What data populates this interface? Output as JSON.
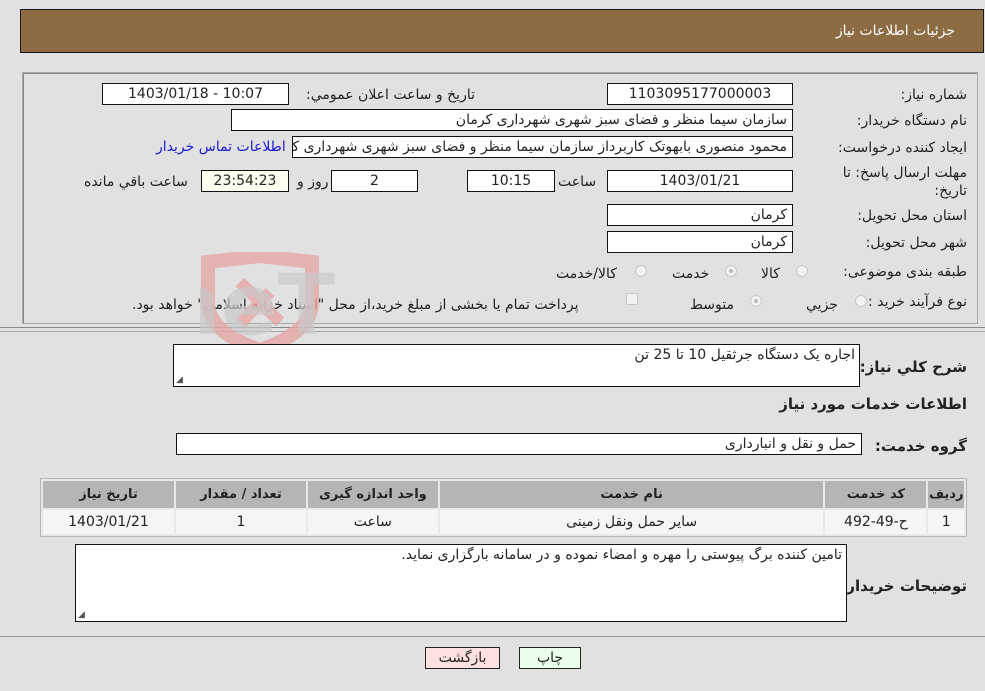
{
  "header": {
    "title": "جزئیات اطلاعات نیاز"
  },
  "form": {
    "need_number": {
      "label": "شماره نیاز:",
      "value": "1103095177000003"
    },
    "announce_datetime": {
      "label": "تاریخ و ساعت اعلان عمومي:",
      "value": "1403/01/18 - 10:07"
    },
    "buyer_org": {
      "label": "نام دستگاه خریدار:",
      "value": "سازمان سیما منظر و فضای سبز شهری شهرداری کرمان"
    },
    "requester": {
      "label": "ایجاد کننده درخواست:",
      "value": "محمود منصوری بابهوتک کاربرداز سازمان سیما منظر و فضای سبز شهری شهرداری کرمان"
    },
    "buyer_contact_link": "اطلاعات تماس خریدار",
    "deadline": {
      "label": "مهلت ارسال پاسخ: تا تاریخ:",
      "date": "1403/01/21",
      "time_label": "ساعت",
      "time": "10:15",
      "days": "2",
      "days_label": "روز و",
      "remaining": "23:54:23",
      "remaining_label": "ساعت باقي مانده"
    },
    "province": {
      "label": "استان محل تحویل:",
      "value": "کرمان"
    },
    "city": {
      "label": "شهر محل تحویل:",
      "value": "کرمان"
    },
    "category": {
      "label": "طبقه بندی موضوعی:",
      "options": [
        "کالا",
        "خدمت",
        "کالا/خدمت"
      ],
      "selected": "خدمت"
    },
    "purchase_type": {
      "label": "نوع فرآیند خرید :",
      "options": [
        "جزيي",
        "متوسط"
      ],
      "selected": "متوسط",
      "treasury_note": "پرداخت تمام یا بخشی از مبلغ خرید،از محل \"اسناد خزانه اسلامی\" خواهد بود."
    }
  },
  "summary": {
    "label": "شرح کلي نیاز:",
    "value": "اجاره یک دستگاه جرثقیل 10 تا 25 تن"
  },
  "services": {
    "section_title": "اطلاعات خدمات مورد نیاز",
    "group_label": "گروه خدمت:",
    "group_value": "حمل و نقل و انبارداری",
    "table": {
      "headers": [
        "ردیف",
        "کد خدمت",
        "نام خدمت",
        "واحد اندازه گیری",
        "تعداد / مقدار",
        "تاریخ نیاز"
      ],
      "rows": [
        [
          "1",
          "ح-49-492",
          "سایر حمل ونقل زمینی",
          "ساعت",
          "1",
          "1403/01/21"
        ]
      ]
    }
  },
  "buyer_notes": {
    "label": "توضیحات خریدار:",
    "value": "تامین کننده برگ پیوستی را مهره و امضاء نموده و در سامانه بارگزاری نماید."
  },
  "buttons": {
    "print": "چاپ",
    "back": "بازگشت"
  },
  "colors": {
    "header_bg": "#8d6c44",
    "print_bg": "#eaffea",
    "back_bg": "#ffe0e0",
    "link": "#1a1ad6"
  },
  "watermark": {
    "text": "AriaTender.neT"
  }
}
